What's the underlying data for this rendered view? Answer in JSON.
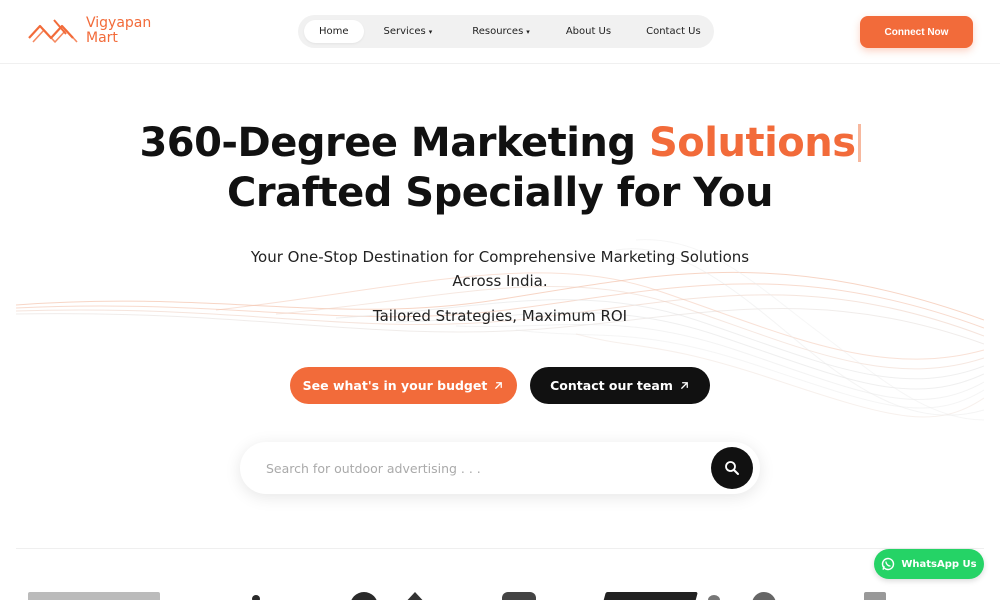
{
  "brand": {
    "name_line1": "Vigyapan",
    "name_line2": "Mart",
    "accent": "#f26b3a"
  },
  "nav": {
    "items": [
      {
        "label": "Home",
        "active": true
      },
      {
        "label": "Services",
        "caret": "▾"
      },
      {
        "label": "Resources",
        "caret": "▾"
      },
      {
        "label": "About Us"
      },
      {
        "label": "Contact Us"
      }
    ]
  },
  "header": {
    "cta_label": "Connect Now"
  },
  "hero": {
    "title_part1": "360-Degree Marketing ",
    "title_accent": "Solutions",
    "title_line2": "Crafted Specially for You",
    "subtitle": "Your One-Stop Destination for Comprehensive Marketing Solutions Across India.",
    "tagline": "Tailored Strategies, Maximum ROI",
    "primary_button": "See what's in your budget",
    "secondary_button": "Contact our team"
  },
  "search": {
    "placeholder": "Search for outdoor advertising . . ."
  },
  "whatsapp": {
    "label": "WhatsApp Us",
    "color": "#25d366"
  },
  "icons": {
    "arrow": "arrow-up-right-icon",
    "search": "search-icon",
    "whatsapp": "whatsapp-icon"
  }
}
